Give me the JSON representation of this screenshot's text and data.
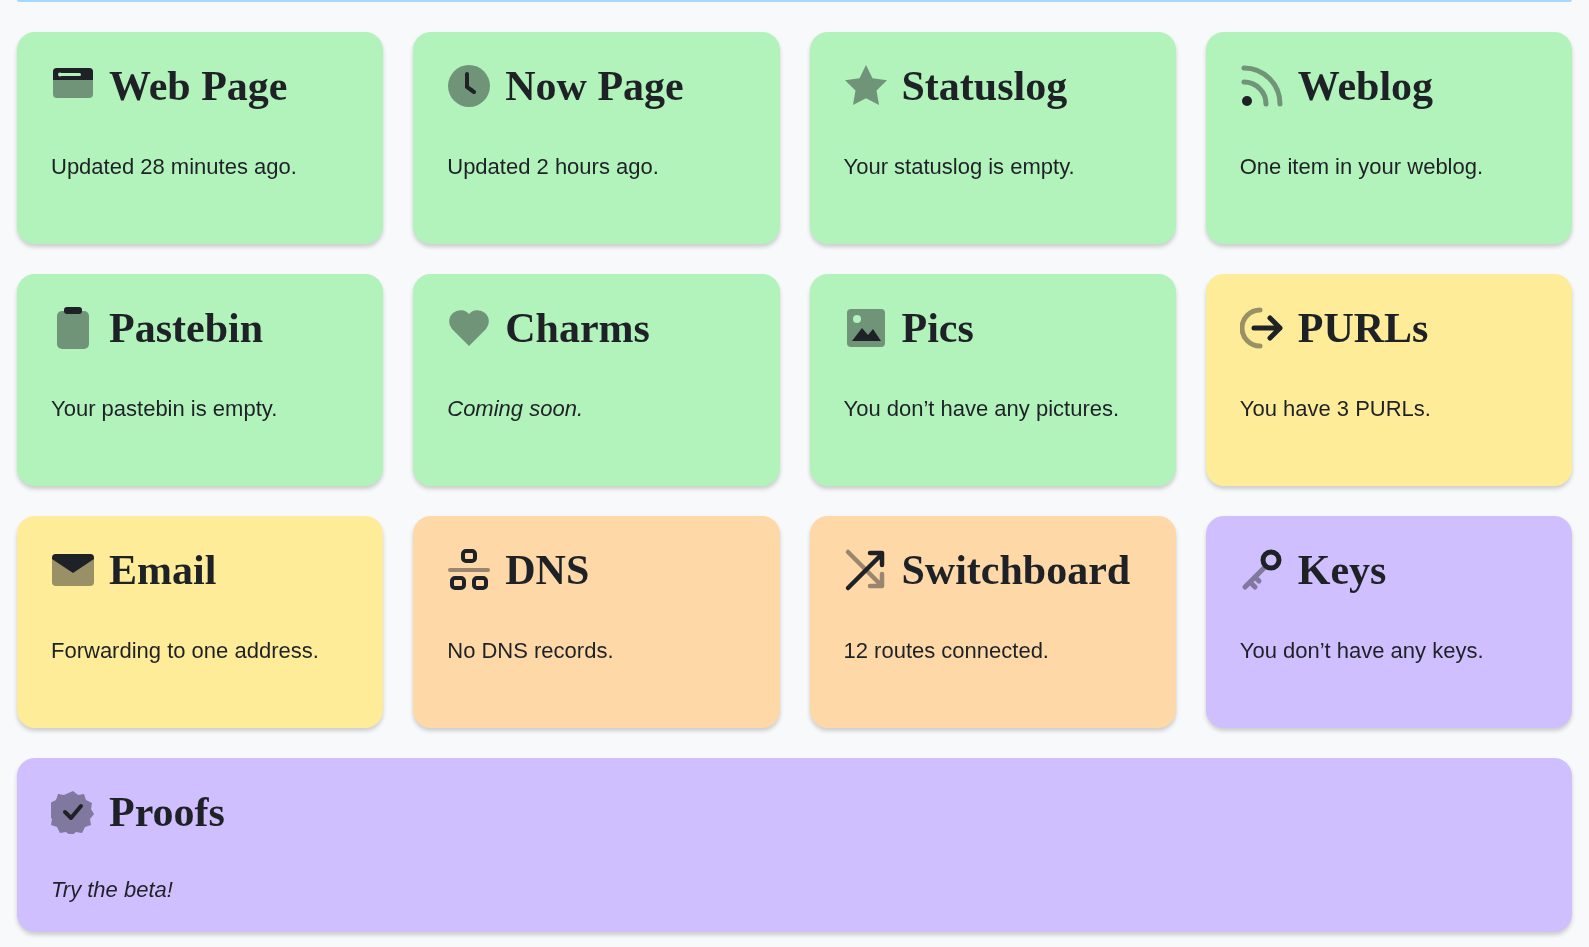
{
  "cards": [
    {
      "kind": "browser",
      "title": "Web Page",
      "text": "Updated 28 minutes ago.",
      "italic": false,
      "wide": false,
      "color": "#b2f2bb"
    },
    {
      "kind": "clock",
      "title": "Now Page",
      "text": "Updated 2 hours ago.",
      "italic": false,
      "wide": false,
      "color": "#b2f2bb"
    },
    {
      "kind": "star",
      "title": "Statuslog",
      "text": "Your statuslog is empty.",
      "italic": false,
      "wide": false,
      "color": "#b2f2bb"
    },
    {
      "kind": "rss",
      "title": "Weblog",
      "text": "One item in your weblog.",
      "italic": false,
      "wide": false,
      "color": "#b2f2bb"
    },
    {
      "kind": "clipboard",
      "title": "Pastebin",
      "text": "Your pastebin is empty.",
      "italic": false,
      "wide": false,
      "color": "#b2f2bb"
    },
    {
      "kind": "heart",
      "title": "Charms",
      "text": "Coming soon.",
      "italic": true,
      "wide": false,
      "color": "#b2f2bb"
    },
    {
      "kind": "image",
      "title": "Pics",
      "text": "You don’t have any pictures.",
      "italic": false,
      "wide": false,
      "color": "#b2f2bb"
    },
    {
      "kind": "arrow",
      "title": "PURLs",
      "text": "You have 3 PURLs.",
      "italic": false,
      "wide": false,
      "color": "#ffec99"
    },
    {
      "kind": "envelope",
      "title": "Email",
      "text": "Forwarding to one address.",
      "italic": false,
      "wide": false,
      "color": "#ffec99"
    },
    {
      "kind": "network",
      "title": "DNS",
      "text": "No DNS records.",
      "italic": false,
      "wide": false,
      "color": "#ffd8a8"
    },
    {
      "kind": "shuffle",
      "title": "Switchboard",
      "text": "12 routes connected.",
      "italic": false,
      "wide": false,
      "color": "#ffd8a8"
    },
    {
      "kind": "key",
      "title": "Keys",
      "text": "You don’t have any keys.",
      "italic": false,
      "wide": false,
      "color": "#d0bfff"
    },
    {
      "kind": "badge",
      "title": "Proofs",
      "text": "Try the beta!",
      "italic": true,
      "wide": true,
      "color": "#d0bfff"
    }
  ]
}
